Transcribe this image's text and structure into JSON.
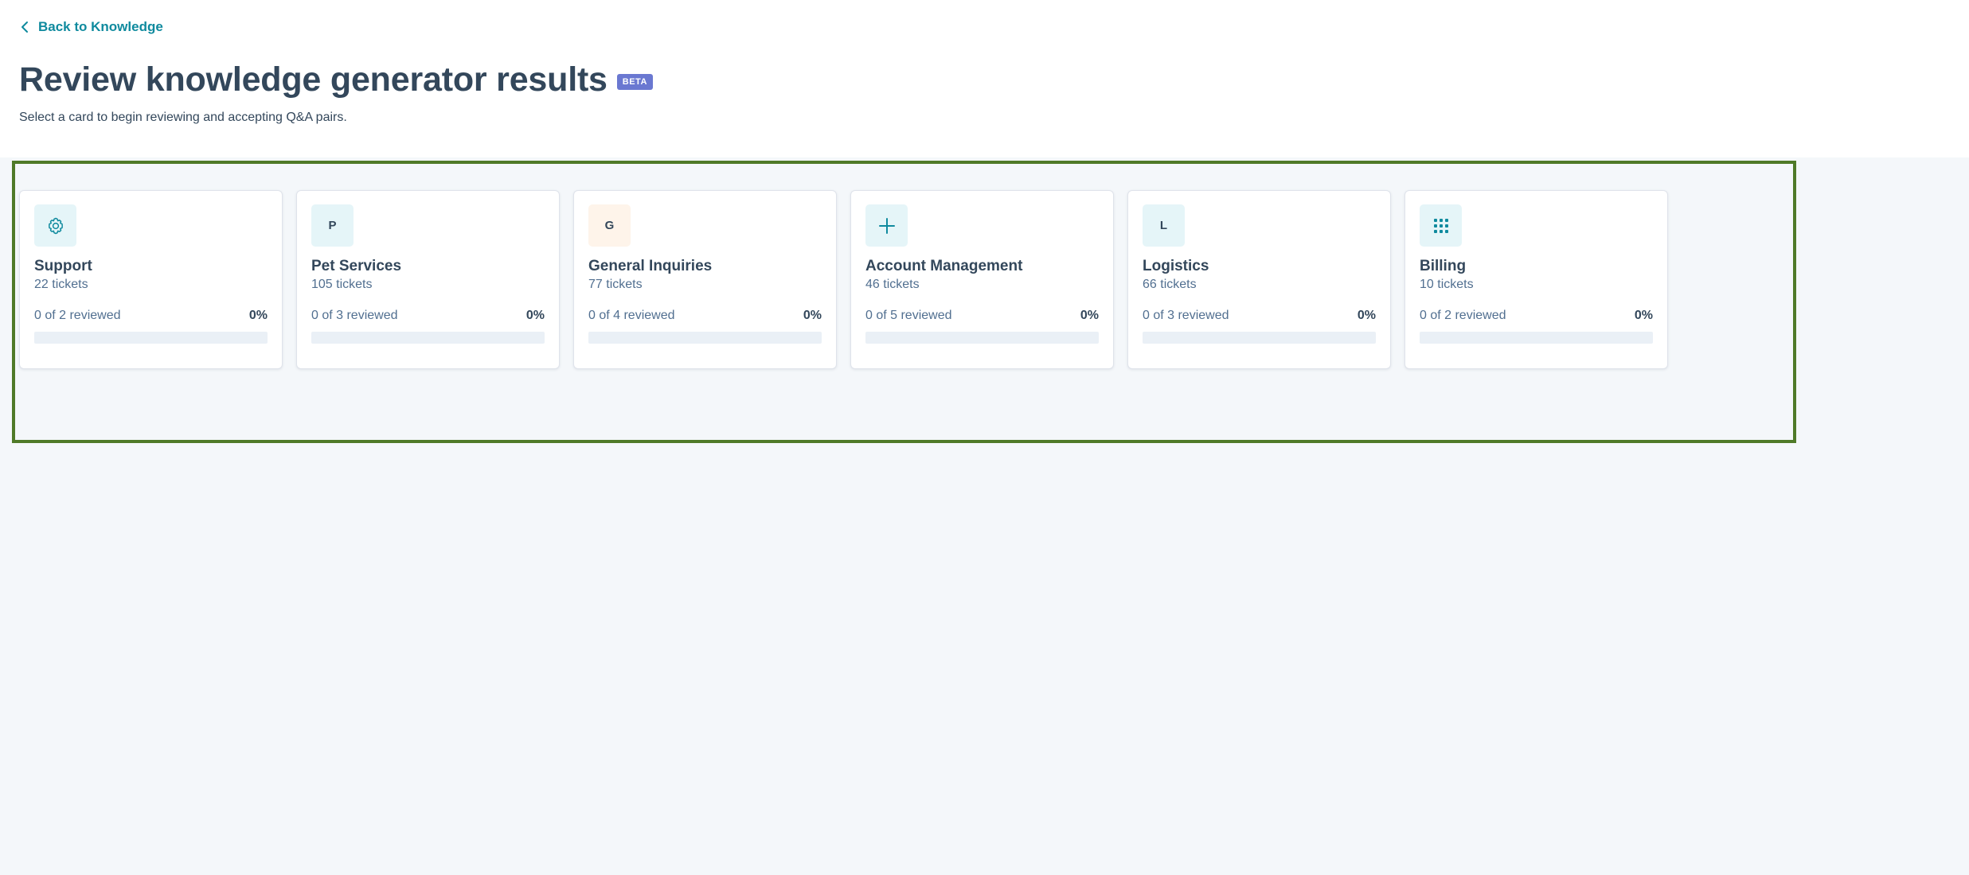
{
  "nav": {
    "back_label": "Back to Knowledge"
  },
  "header": {
    "title": "Review knowledge generator results",
    "badge": "BETA",
    "subtitle": "Select a card to begin reviewing and accepting Q&A pairs."
  },
  "colors": {
    "accent": "#0f8a9e",
    "badge_bg": "#6a78d1",
    "selection_border": "#4f7a28",
    "icon_teal_bg": "#e5f5f8",
    "icon_orange_bg": "#fef4ea",
    "progress_track": "#eaf0f6"
  },
  "cards": [
    {
      "name": "Support",
      "tickets": "22 tickets",
      "reviewed": "0 of 2 reviewed",
      "percent": "0%",
      "progress": 0,
      "icon": "gear-icon",
      "icon_text": ""
    },
    {
      "name": "Pet Services",
      "tickets": "105 tickets",
      "reviewed": "0 of 3 reviewed",
      "percent": "0%",
      "progress": 0,
      "icon": "letter-p-icon",
      "icon_text": "P"
    },
    {
      "name": "General Inquiries",
      "tickets": "77 tickets",
      "reviewed": "0 of 4 reviewed",
      "percent": "0%",
      "progress": 0,
      "icon": "letter-g-icon",
      "icon_text": "G"
    },
    {
      "name": "Account Management",
      "tickets": "46 tickets",
      "reviewed": "0 of 5 reviewed",
      "percent": "0%",
      "progress": 0,
      "icon": "plus-icon",
      "icon_text": ""
    },
    {
      "name": "Logistics",
      "tickets": "66 tickets",
      "reviewed": "0 of 3 reviewed",
      "percent": "0%",
      "progress": 0,
      "icon": "letter-l-icon",
      "icon_text": "L"
    },
    {
      "name": "Billing",
      "tickets": "10 tickets",
      "reviewed": "0 of 2 reviewed",
      "percent": "0%",
      "progress": 0,
      "icon": "grid-icon",
      "icon_text": ""
    }
  ]
}
